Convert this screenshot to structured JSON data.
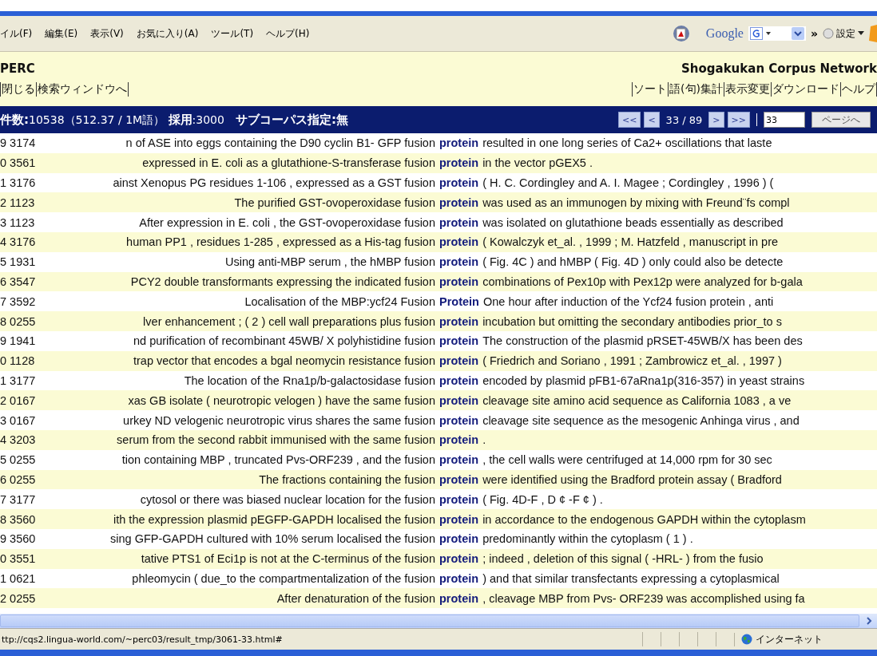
{
  "menu": [
    "イル(F)",
    "編集(E)",
    "表示(V)",
    "お気に入り(A)",
    "ツール(T)",
    "ヘルプ(H)"
  ],
  "toolbar": {
    "search_brand": "Google",
    "chevron": "»",
    "settings": "設定"
  },
  "header": {
    "title": "PERC",
    "network": "Shogakukan Corpus Network",
    "left_links": [
      "閉じる",
      "検索ウィンドウへ"
    ],
    "right_links": [
      "ソート",
      "語(句)集計",
      "表示変更",
      "ダウンロード",
      "ヘルプ"
    ]
  },
  "summary": "**件数:**10538（512.37 / 1M語） **採用**:3000　**サブコーパス指定:無**",
  "pager": {
    "first": "<<",
    "prev": "<",
    "position": "33 / 89",
    "next": ">",
    "last": ">>",
    "page_value": "33",
    "go": "ページへ"
  },
  "rows": [
    {
      "num": "9 3174",
      "left": "n of ASE into eggs containing the D90 cyclin B1- GFP fusion",
      "key": "protein",
      "right": "resulted in one long series of Ca2+ oscillations that laste"
    },
    {
      "num": "0 3561",
      "left": "expressed in E. coli as a glutathione-S-transferase fusion",
      "key": "protein",
      "right": "in the vector pGEX5 ."
    },
    {
      "num": "1 3176",
      "left": "ainst Xenopus PG residues 1-106 , expressed as a GST fusion",
      "key": "protein",
      "right": "( H. C. Cordingley and A. I. Magee ; Cordingley , 1996 ) ("
    },
    {
      "num": "2 1123",
      "left": "The purified GST-ovoperoxidase fusion",
      "key": "protein",
      "right": "was used as an immunogen by mixing with Freund¨fs compl"
    },
    {
      "num": "3 1123",
      "left": "After expression in E. coli , the GST-ovoperoxidase fusion",
      "key": "protein",
      "right": "was isolated on glutathione beads essentially as described"
    },
    {
      "num": "4 3176",
      "left": "human PP1 , residues 1-285 , expressed as a His-tag fusion",
      "key": "protein",
      "right": "( Kowalczyk et_al. , 1999 ; M. Hatzfeld , manuscript in pre"
    },
    {
      "num": "5 1931",
      "left": "Using anti-MBP serum , the hMBP fusion",
      "key": "protein",
      "right": "( Fig. 4C ) and hMBP ( Fig. 4D ) only could also be detecte"
    },
    {
      "num": "6 3547",
      "left": "PCY2 double transformants expressing the indicated fusion",
      "key": "protein",
      "right": "combinations of Pex10p with Pex12p were analyzed for b-gala"
    },
    {
      "num": "7 3592",
      "left": "Localisation of the MBP:ycf24 Fusion",
      "key": "Protein",
      "right": "One hour after induction of the Ycf24 fusion protein , anti"
    },
    {
      "num": "8 0255",
      "left": "lver enhancement ; ( 2 ) cell wall preparations plus fusion",
      "key": "protein",
      "right": "incubation but omitting the secondary antibodies prior_to s"
    },
    {
      "num": "9 1941",
      "left": "nd purification of recombinant 45WB/ X polyhistidine fusion",
      "key": "protein",
      "right": "The construction of the plasmid pRSET-45WB/X has been des"
    },
    {
      "num": "0 1128",
      "left": "trap vector that encodes a bgal neomycin resistance fusion",
      "key": "protein",
      "right": "( Friedrich and Soriano , 1991 ; Zambrowicz et_al. , 1997 )"
    },
    {
      "num": "1 3177",
      "left": "The location of the Rna1p/b-galactosidase fusion",
      "key": "protein",
      "right": "encoded by plasmid pFB1-67aRna1p(316-357) in yeast strains"
    },
    {
      "num": "2 0167",
      "left": "xas GB isolate ( neurotropic velogen ) have the same fusion",
      "key": "protein",
      "right": "cleavage site amino acid sequence as California 1083 , a ve"
    },
    {
      "num": "3 0167",
      "left": "urkey ND velogenic neurotropic virus shares the same fusion",
      "key": "protein",
      "right": "cleavage site sequence as the mesogenic Anhinga virus , and"
    },
    {
      "num": "4 3203",
      "left": "serum from the second rabbit immunised with the same fusion",
      "key": "protein",
      "right": "."
    },
    {
      "num": "5 0255",
      "left": "tion containing MBP , truncated Pvs-ORF239 , and the fusion",
      "key": "protein",
      "right": ", the cell walls were centrifuged at 14,000 rpm for 30 sec"
    },
    {
      "num": "6 0255",
      "left": "The fractions containing the fusion",
      "key": "protein",
      "right": "were identified using the Bradford protein assay ( Bradford"
    },
    {
      "num": "7 3177",
      "left": "cytosol or there was biased nuclear location for the fusion",
      "key": "protein",
      "right": "( Fig. 4D-F , D ¢ -F ¢ ) ."
    },
    {
      "num": "8 3560",
      "left": "ith the expression plasmid pEGFP-GAPDH localised the fusion",
      "key": "protein",
      "right": "in accordance to the endogenous GAPDH within the cytoplasm"
    },
    {
      "num": "9 3560",
      "left": "sing GFP-GAPDH cultured with 10% serum localised the fusion",
      "key": "protein",
      "right": "predominantly within the cytoplasm ( 1 ) ."
    },
    {
      "num": "0 3551",
      "left": "tative PTS1 of Eci1p is not at the C-terminus of the fusion",
      "key": "protein",
      "right": "; indeed , deletion of this signal ( -HRL- ) from the fusio"
    },
    {
      "num": "1 0621",
      "left": "phleomycin ( due_to the compartmentalization of the fusion",
      "key": "protein",
      "right": ") and that similar transfectants expressing a cytoplasmical"
    },
    {
      "num": "2 0255",
      "left": "After denaturation of the fusion",
      "key": "protein",
      "right": ", cleavage MBP from Pvs- ORF239 was accomplished using fa"
    }
  ],
  "status_bar": {
    "url": "ttp://cqs2.lingua-world.com/~perc03/result_tmp/3061-33.html#",
    "zone": "インターネット"
  }
}
